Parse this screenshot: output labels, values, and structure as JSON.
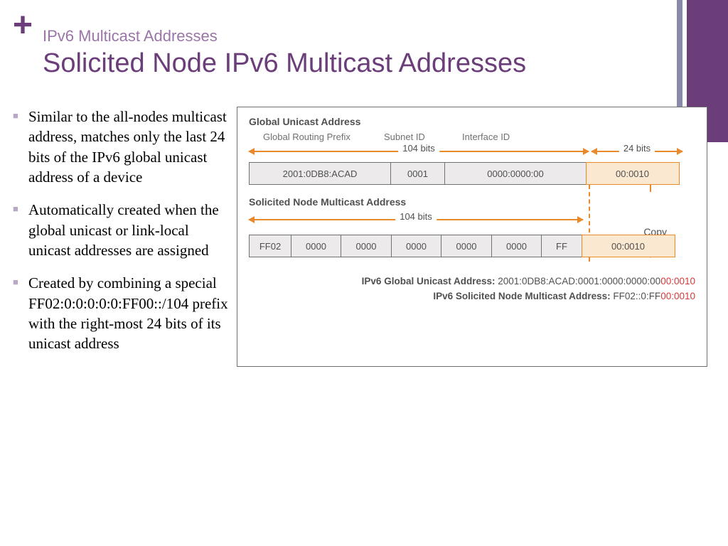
{
  "plus_icon": "+",
  "eyebrow": "IPv6 Multicast Addresses",
  "title": "Solicited Node IPv6 Multicast Addresses",
  "bullets": [
    "Similar to the all-nodes multicast address, matches only the last 24 bits of the IPv6 global unicast address of a device",
    "Automatically created when the global unicast or link-local unicast addresses are assigned",
    "Created by combining a special FF02:0:0:0:0:0:FF00::/104 prefix with the right-most 24 bits of its unicast address"
  ],
  "diagram": {
    "section1": {
      "title": "Global Unicast Address",
      "sublabels": [
        "Global Routing Prefix",
        "Subnet ID",
        "Interface ID"
      ],
      "arrow1_label": "104 bits",
      "arrow2_label": "24 bits",
      "cells": [
        "2001:0DB8:ACAD",
        "0001",
        "0000:0000:00",
        "00:0010"
      ]
    },
    "copy_label": "Copy",
    "section2": {
      "title": "Solicited Node Multicast Address",
      "arrow1_label": "104 bits",
      "cells": [
        "FF02",
        "0000",
        "0000",
        "0000",
        "0000",
        "0000",
        "FF",
        "00:0010"
      ]
    },
    "footer": {
      "line1_label": "IPv6 Global Unicast Address:",
      "line1_black": "2001:0DB8:ACAD:0001:0000:0000:00",
      "line1_red": "00:0010",
      "line2_label": "IPv6 Solicited Node Multicast Address:",
      "line2_black": "FF02::0:FF",
      "line2_red": "00:0010"
    }
  }
}
